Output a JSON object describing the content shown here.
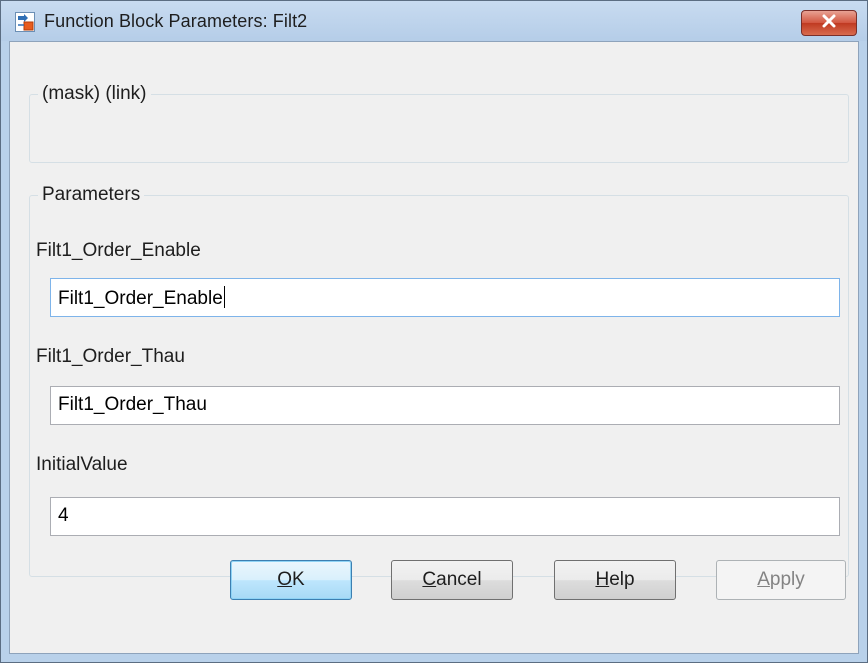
{
  "window": {
    "title": "Function Block Parameters: Filt2"
  },
  "mask_group": {
    "legend": "(mask) (link)"
  },
  "parameters": {
    "legend": "Parameters",
    "fields": [
      {
        "label": "Filt1_Order_Enable",
        "value": "Filt1_Order_Enable"
      },
      {
        "label": "Filt1_Order_Thau",
        "value": "Filt1_Order_Thau"
      },
      {
        "label": "InitialValue",
        "value": "4"
      }
    ]
  },
  "buttons": {
    "ok": {
      "mnemonic": "O",
      "rest": "K"
    },
    "cancel": {
      "mnemonic": "C",
      "rest": "ancel"
    },
    "help": {
      "mnemonic": "H",
      "rest": "elp"
    },
    "apply": {
      "mnemonic": "A",
      "rest": "pply"
    }
  },
  "icons": {
    "app": "simulink-block-icon",
    "close": "close-icon"
  },
  "colors": {
    "titlebar": "#b9d1ea",
    "close_button": "#c7432a",
    "default_button": "#bee6fd"
  }
}
